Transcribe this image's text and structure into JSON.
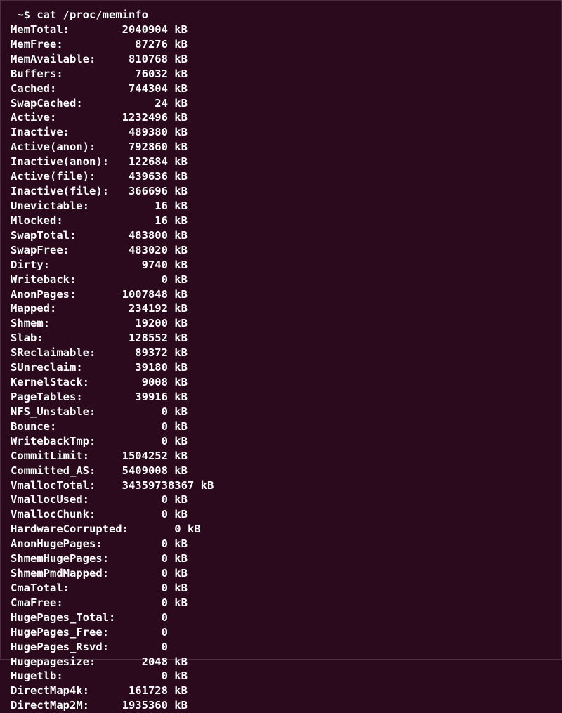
{
  "prompt": " ~$ ",
  "command": "cat /proc/meminfo",
  "entries": [
    {
      "key": "MemTotal",
      "label": "MemTotal:",
      "value": "2040904",
      "unit": "kB"
    },
    {
      "key": "MemFree",
      "label": "MemFree:",
      "value": "87276",
      "unit": "kB"
    },
    {
      "key": "MemAvailable",
      "label": "MemAvailable:",
      "value": "810768",
      "unit": "kB"
    },
    {
      "key": "Buffers",
      "label": "Buffers:",
      "value": "76032",
      "unit": "kB"
    },
    {
      "key": "Cached",
      "label": "Cached:",
      "value": "744304",
      "unit": "kB"
    },
    {
      "key": "SwapCached",
      "label": "SwapCached:",
      "value": "24",
      "unit": "kB"
    },
    {
      "key": "Active",
      "label": "Active:",
      "value": "1232496",
      "unit": "kB"
    },
    {
      "key": "Inactive",
      "label": "Inactive:",
      "value": "489380",
      "unit": "kB"
    },
    {
      "key": "ActiveAnon",
      "label": "Active(anon):",
      "value": "792860",
      "unit": "kB"
    },
    {
      "key": "InactiveAnon",
      "label": "Inactive(anon):",
      "value": "122684",
      "unit": "kB"
    },
    {
      "key": "ActiveFile",
      "label": "Active(file):",
      "value": "439636",
      "unit": "kB"
    },
    {
      "key": "InactiveFile",
      "label": "Inactive(file):",
      "value": "366696",
      "unit": "kB"
    },
    {
      "key": "Unevictable",
      "label": "Unevictable:",
      "value": "16",
      "unit": "kB"
    },
    {
      "key": "Mlocked",
      "label": "Mlocked:",
      "value": "16",
      "unit": "kB"
    },
    {
      "key": "SwapTotal",
      "label": "SwapTotal:",
      "value": "483800",
      "unit": "kB"
    },
    {
      "key": "SwapFree",
      "label": "SwapFree:",
      "value": "483020",
      "unit": "kB"
    },
    {
      "key": "Dirty",
      "label": "Dirty:",
      "value": "9740",
      "unit": "kB"
    },
    {
      "key": "Writeback",
      "label": "Writeback:",
      "value": "0",
      "unit": "kB"
    },
    {
      "key": "AnonPages",
      "label": "AnonPages:",
      "value": "1007848",
      "unit": "kB"
    },
    {
      "key": "Mapped",
      "label": "Mapped:",
      "value": "234192",
      "unit": "kB"
    },
    {
      "key": "Shmem",
      "label": "Shmem:",
      "value": "19200",
      "unit": "kB"
    },
    {
      "key": "Slab",
      "label": "Slab:",
      "value": "128552",
      "unit": "kB"
    },
    {
      "key": "SReclaimable",
      "label": "SReclaimable:",
      "value": "89372",
      "unit": "kB"
    },
    {
      "key": "SUnreclaim",
      "label": "SUnreclaim:",
      "value": "39180",
      "unit": "kB"
    },
    {
      "key": "KernelStack",
      "label": "KernelStack:",
      "value": "9008",
      "unit": "kB"
    },
    {
      "key": "PageTables",
      "label": "PageTables:",
      "value": "39916",
      "unit": "kB"
    },
    {
      "key": "NFS_Unstable",
      "label": "NFS_Unstable:",
      "value": "0",
      "unit": "kB"
    },
    {
      "key": "Bounce",
      "label": "Bounce:",
      "value": "0",
      "unit": "kB"
    },
    {
      "key": "WritebackTmp",
      "label": "WritebackTmp:",
      "value": "0",
      "unit": "kB"
    },
    {
      "key": "CommitLimit",
      "label": "CommitLimit:",
      "value": "1504252",
      "unit": "kB"
    },
    {
      "key": "Committed_AS",
      "label": "Committed_AS:",
      "value": "5409008",
      "unit": "kB"
    },
    {
      "key": "VmallocTotal",
      "label": "VmallocTotal:",
      "value": "34359738367",
      "unit": "kB"
    },
    {
      "key": "VmallocUsed",
      "label": "VmallocUsed:",
      "value": "0",
      "unit": "kB"
    },
    {
      "key": "VmallocChunk",
      "label": "VmallocChunk:",
      "value": "0",
      "unit": "kB"
    },
    {
      "key": "HardwareCorrupted",
      "label": "HardwareCorrupted:",
      "value": "0",
      "unit": "kB"
    },
    {
      "key": "AnonHugePages",
      "label": "AnonHugePages:",
      "value": "0",
      "unit": "kB"
    },
    {
      "key": "ShmemHugePages",
      "label": "ShmemHugePages:",
      "value": "0",
      "unit": "kB"
    },
    {
      "key": "ShmemPmdMapped",
      "label": "ShmemPmdMapped:",
      "value": "0",
      "unit": "kB"
    },
    {
      "key": "CmaTotal",
      "label": "CmaTotal:",
      "value": "0",
      "unit": "kB"
    },
    {
      "key": "CmaFree",
      "label": "CmaFree:",
      "value": "0",
      "unit": "kB"
    },
    {
      "key": "HugePages_Total",
      "label": "HugePages_Total:",
      "value": "0",
      "unit": ""
    },
    {
      "key": "HugePages_Free",
      "label": "HugePages_Free:",
      "value": "0",
      "unit": ""
    },
    {
      "key": "HugePages_Rsvd",
      "label": "HugePages_Rsvd:",
      "value": "0",
      "unit": ""
    },
    {
      "key": "Hugepagesize",
      "label": "Hugepagesize:",
      "value": "2048",
      "unit": "kB"
    },
    {
      "key": "Hugetlb",
      "label": "Hugetlb:",
      "value": "0",
      "unit": "kB"
    },
    {
      "key": "DirectMap4k",
      "label": "DirectMap4k:",
      "value": "161728",
      "unit": "kB"
    },
    {
      "key": "DirectMap2M",
      "label": "DirectMap2M:",
      "value": "1935360",
      "unit": "kB"
    }
  ],
  "layout": {
    "labelWidth": 16,
    "valueWidth": 8,
    "longValueWidth": 12
  }
}
